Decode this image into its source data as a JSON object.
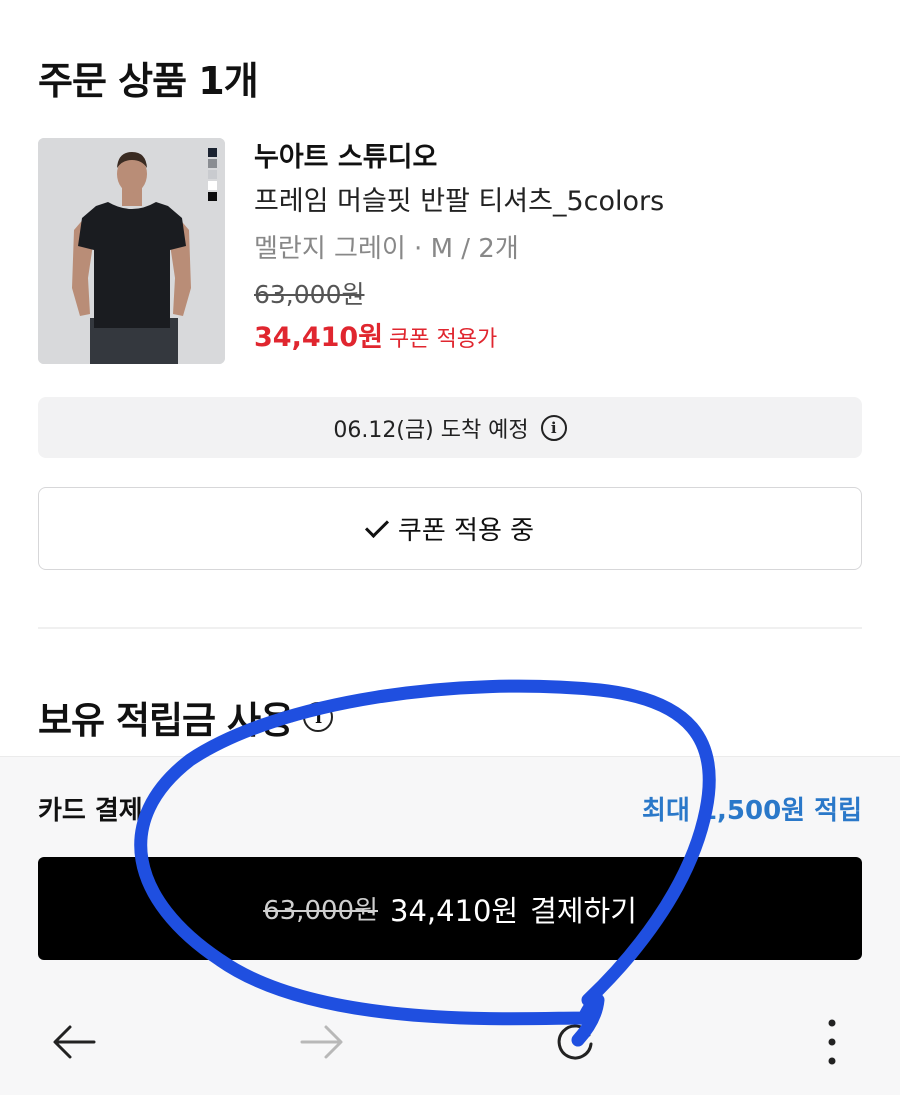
{
  "order": {
    "title": "주문 상품 1개"
  },
  "product": {
    "brand": "누아트 스튜디오",
    "name": "프레임 머슬핏 반팔 티셔츠_5colors",
    "option": "멜란지 그레이 · M / 2개",
    "original_price": "63,000원",
    "sale_price": "34,410원",
    "sale_note": "쿠폰 적용가",
    "swatch_colors": [
      "#1a2230",
      "#8a8d92",
      "#c9cbcf",
      "#ffffff",
      "#0b0b0c"
    ]
  },
  "delivery": {
    "text": "06.12(금) 도착 예정",
    "icon": "info-icon"
  },
  "coupon": {
    "label": "쿠폰 적용 중",
    "icon": "check-icon"
  },
  "points": {
    "title": "보유 적립금 사용",
    "icon": "info-icon"
  },
  "payment": {
    "method": "카드 결제",
    "reward_text": "최대 1,500원 적립",
    "button_original": "63,000원",
    "button_price": "34,410원",
    "button_label": "결제하기"
  },
  "navbar": {
    "icons": [
      "back-arrow-icon",
      "forward-arrow-icon",
      "refresh-icon",
      "more-vertical-icon"
    ]
  },
  "colors": {
    "sale_red": "#e0262f",
    "reward_blue": "#2a78c9",
    "pay_button": "#000000",
    "annotation_blue": "#1f4fe0"
  }
}
